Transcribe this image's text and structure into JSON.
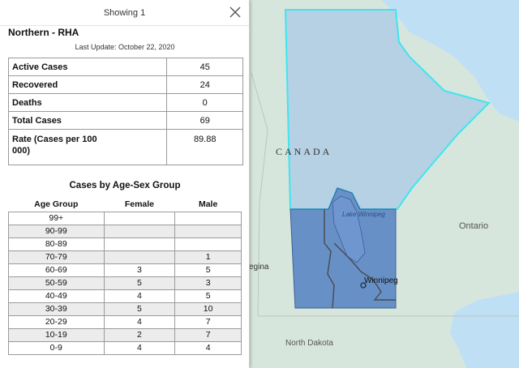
{
  "popup": {
    "showing": "Showing 1",
    "region_name": "Northern - RHA",
    "last_update": "Last Update: October 22, 2020",
    "stats": [
      {
        "label": "Active Cases",
        "value": "45"
      },
      {
        "label": "Recovered",
        "value": "24"
      },
      {
        "label": "Deaths",
        "value": "0"
      },
      {
        "label": "Total Cases",
        "value": "69"
      },
      {
        "label": "Rate (Cases per 100 000)",
        "value": "89.88"
      }
    ],
    "age_table": {
      "title": "Cases by Age-Sex Group",
      "headers": [
        "Age Group",
        "Female",
        "Male"
      ],
      "rows": [
        [
          "99+",
          "",
          ""
        ],
        [
          "90-99",
          "",
          ""
        ],
        [
          "80-89",
          "",
          ""
        ],
        [
          "70-79",
          "",
          "1"
        ],
        [
          "60-69",
          "3",
          "5"
        ],
        [
          "50-59",
          "5",
          "3"
        ],
        [
          "40-49",
          "4",
          "5"
        ],
        [
          "30-39",
          "5",
          "10"
        ],
        [
          "20-29",
          "4",
          "7"
        ],
        [
          "10-19",
          "2",
          "7"
        ],
        [
          "0-9",
          "4",
          "4"
        ]
      ]
    }
  },
  "map": {
    "labels": {
      "country": "CANADA",
      "ontario": "Ontario",
      "lake": "Lake Winnipeg",
      "city": "Winnipeg",
      "regina": "egina",
      "north_dakota": "North Dakota"
    },
    "colors": {
      "land": "#d7e6dc",
      "water": "#bfe0f4",
      "selected_region": "#b2cfe3",
      "selected_outline": "#3ee6f0",
      "southern_regions": "#5b86c4",
      "region_borders": "#4a4a4a"
    }
  }
}
